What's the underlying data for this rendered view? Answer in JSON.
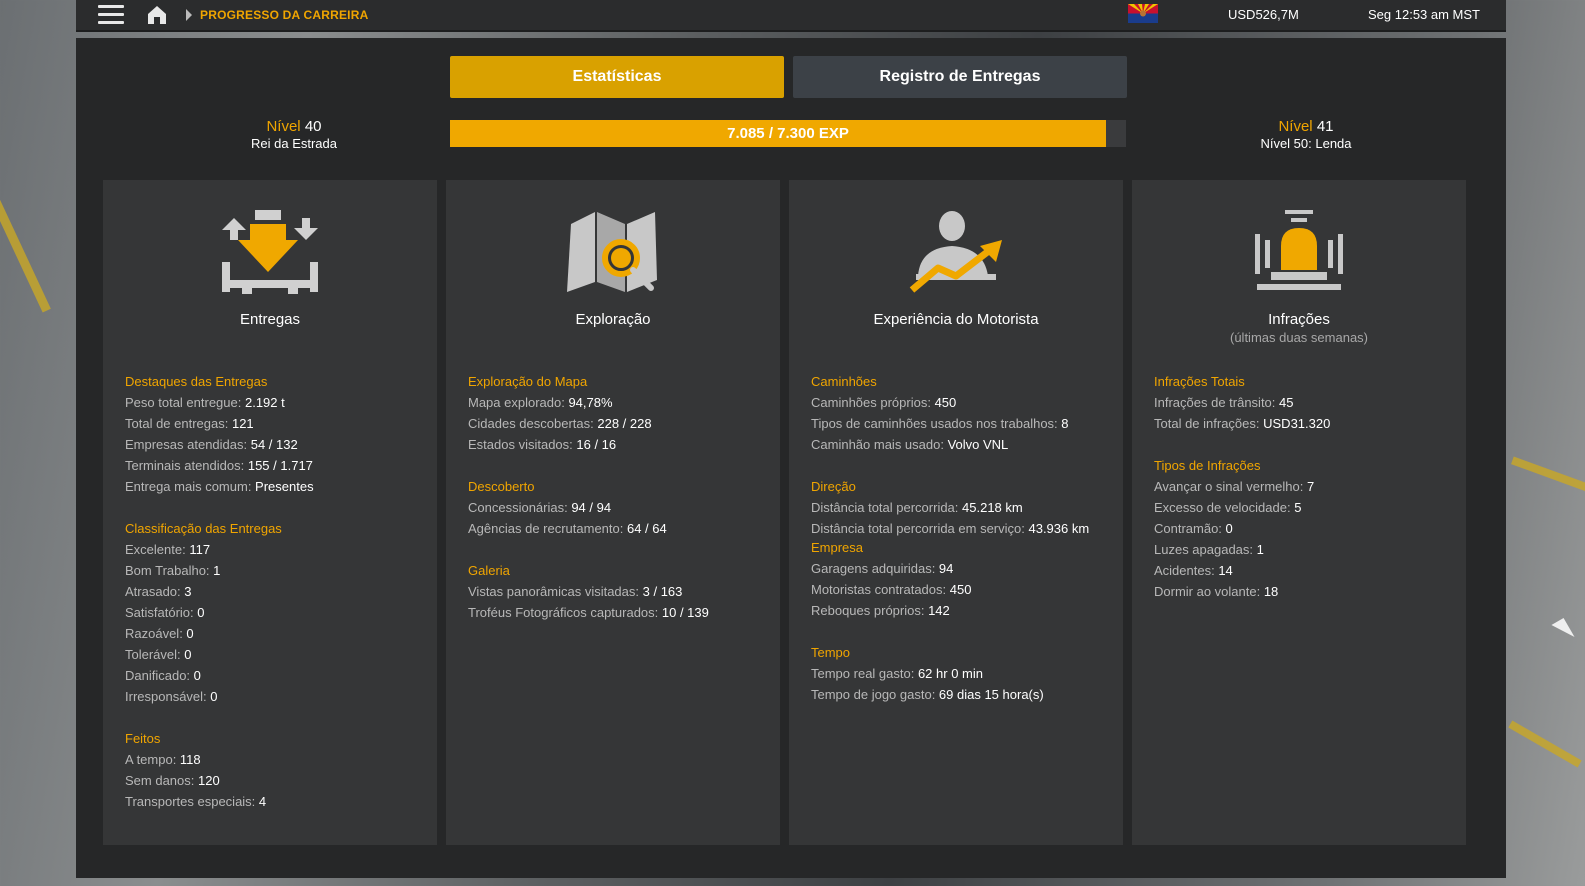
{
  "topbar": {
    "breadcrumb": "PROGRESSO DA CARREIRA",
    "money": "USD526,7M",
    "clock": "Seg 12:53 am MST"
  },
  "tabs": {
    "stats": "Estatísticas",
    "deliveries_log": "Registro de Entregas"
  },
  "level_current": {
    "label": "Nível",
    "value": "40",
    "title": "Rei da Estrada"
  },
  "level_next": {
    "label": "Nível",
    "value": "41",
    "title": "Nível 50: Lenda"
  },
  "xp": {
    "text": "7.085 / 7.300 EXP",
    "progress": 0.97
  },
  "cards": [
    {
      "title": "Entregas",
      "subtitle": "",
      "sections": [
        {
          "heading": "Destaques das Entregas",
          "rows": [
            {
              "label": "Peso total entregue: ",
              "value": "2.192 t"
            },
            {
              "label": "Total de entregas: ",
              "value": "121"
            },
            {
              "label": "Empresas atendidas: ",
              "value": "54 / 132"
            },
            {
              "label": "Terminais atendidos: ",
              "value": "155 / 1.717"
            },
            {
              "label": "Entrega mais comum: ",
              "value": "Presentes"
            }
          ]
        },
        {
          "heading": "Classificação das Entregas",
          "rows": [
            {
              "label": "Excelente: ",
              "value": "117"
            },
            {
              "label": "Bom Trabalho: ",
              "value": "1"
            },
            {
              "label": "Atrasado: ",
              "value": "3"
            },
            {
              "label": "Satisfatório: ",
              "value": "0"
            },
            {
              "label": "Razoável: ",
              "value": "0"
            },
            {
              "label": "Tolerável: ",
              "value": "0"
            },
            {
              "label": "Danificado: ",
              "value": "0"
            },
            {
              "label": "Irresponsável: ",
              "value": "0"
            }
          ]
        },
        {
          "heading": "Feitos",
          "rows": [
            {
              "label": "A tempo: ",
              "value": "118"
            },
            {
              "label": "Sem danos: ",
              "value": "120"
            },
            {
              "label": "Transportes especiais: ",
              "value": "4"
            }
          ]
        }
      ]
    },
    {
      "title": "Exploração",
      "subtitle": "",
      "sections": [
        {
          "heading": "Exploração do Mapa",
          "rows": [
            {
              "label": "Mapa explorado: ",
              "value": "94,78%"
            },
            {
              "label": "Cidades descobertas: ",
              "value": "228 / 228"
            },
            {
              "label": "Estados visitados: ",
              "value": "16 / 16"
            }
          ]
        },
        {
          "heading": "Descoberto",
          "rows": [
            {
              "label": "Concessionárias: ",
              "value": "94 / 94"
            },
            {
              "label": "Agências de recrutamento: ",
              "value": "64 / 64"
            }
          ]
        },
        {
          "heading": "Galeria",
          "rows": [
            {
              "label": "Vistas panorâmicas visitadas: ",
              "value": "3 / 163"
            },
            {
              "label": "Troféus Fotográficos capturados: ",
              "value": "10 / 139"
            }
          ]
        }
      ]
    },
    {
      "title": "Experiência do Motorista",
      "subtitle": "",
      "sections": [
        {
          "heading": "Caminhões",
          "rows": [
            {
              "label": "Caminhões próprios: ",
              "value": "450"
            },
            {
              "label": "Tipos de caminhões usados nos trabalhos: ",
              "value": "8"
            },
            {
              "label": "Caminhão mais usado: ",
              "value": "Volvo VNL"
            }
          ]
        },
        {
          "heading": "Direção",
          "rows": [
            {
              "label": "Distância total percorrida: ",
              "value": "45.218 km"
            },
            {
              "label": "Distância total percorrida em serviço: ",
              "value": "43.936 km"
            }
          ]
        },
        {
          "heading": "Empresa",
          "nogap": true,
          "rows": [
            {
              "label": "Garagens adquiridas: ",
              "value": "94"
            },
            {
              "label": "Motoristas contratados: ",
              "value": "450"
            },
            {
              "label": "Reboques próprios: ",
              "value": "142"
            }
          ]
        },
        {
          "heading": "Tempo",
          "rows": [
            {
              "label": "Tempo real gasto: ",
              "value": "62 hr 0 min"
            },
            {
              "label": "Tempo de jogo gasto: ",
              "value": "69 dias 15 hora(s)"
            }
          ]
        }
      ]
    },
    {
      "title": "Infrações",
      "subtitle": "(últimas duas semanas)",
      "sections": [
        {
          "heading": "Infrações Totais",
          "rows": [
            {
              "label": "Infrações de trânsito: ",
              "value": "45"
            },
            {
              "label": "Total de infrações: ",
              "value": "USD31.320"
            }
          ]
        },
        {
          "heading": "Tipos de Infrações",
          "rows": [
            {
              "label": "Avançar o sinal vermelho: ",
              "value": "7"
            },
            {
              "label": "Excesso de velocidade: ",
              "value": "5"
            },
            {
              "label": "Contramão: ",
              "value": "0"
            },
            {
              "label": "Luzes apagadas: ",
              "value": "1"
            },
            {
              "label": "Acidentes: ",
              "value": "14"
            },
            {
              "label": "Dormir ao volante: ",
              "value": "18"
            }
          ]
        }
      ]
    }
  ],
  "colors": {
    "accent": "#f0a500",
    "tab_active": "#d9a100",
    "tab_inactive": "#3c4147",
    "card_bg": "#353637",
    "panel_bg": "#262728"
  },
  "icons": [
    "menu-icon",
    "home-icon",
    "chevron-right-icon",
    "arizona-flag-icon",
    "deliveries-icon",
    "map-search-icon",
    "driver-progress-icon",
    "beacon-light-icon"
  ]
}
